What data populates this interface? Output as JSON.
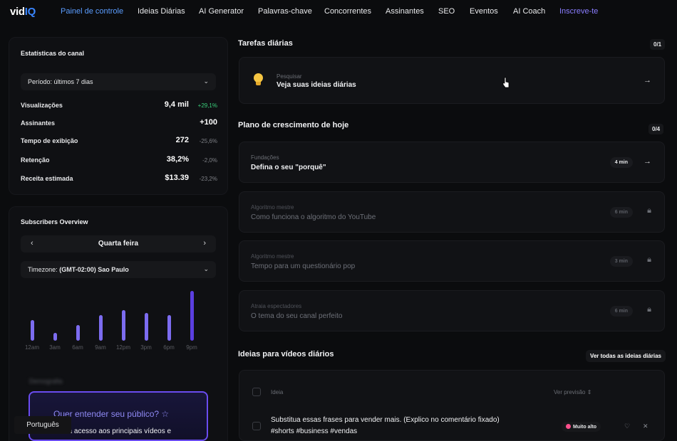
{
  "nav": {
    "logo_prefix": "vid",
    "logo_suffix": "IQ",
    "items": [
      "Painel de controle",
      "Ideias Diárias",
      "AI Generator",
      "Palavras-chave",
      "Concorrentes",
      "Assinantes",
      "SEO",
      "Eventos",
      "AI Coach",
      "Inscreve-te"
    ]
  },
  "stats_panel": {
    "title": "Estatísticas do canal",
    "period": "Período: últimos 7 dias",
    "rows": [
      {
        "label": "Visualizações",
        "value": "9,4 mil",
        "change": "+29,1%"
      },
      {
        "label": "Assinantes",
        "value": "+100",
        "change": ""
      },
      {
        "label": "Tempo de exibição",
        "value": "272",
        "change": "-25,6%"
      },
      {
        "label": "Retenção",
        "value": "38,2%",
        "change": "-2,0%"
      },
      {
        "label": "Receita estimada",
        "value": "$13.39",
        "change": "-23,2%"
      }
    ]
  },
  "subs_panel": {
    "title": "Subscribers Overview",
    "day": "Quarta feira",
    "timezone_label": "Timezone:",
    "timezone_value": "(GMT-02:00) Sao Paulo",
    "bar_labels": [
      "12am",
      "3am",
      "6am",
      "9am",
      "12pm",
      "3pm",
      "6pm",
      "9pm"
    ],
    "bar_levels": [
      0.42,
      0.15,
      0.32,
      0.52,
      0.61,
      0.55,
      0.52,
      1.0
    ],
    "bar_color": "#7c6cf0",
    "blurred_left": "Demografia",
    "promo_title": "Quer entender seu público? ☆",
    "promo_sub": "ha acesso aos principais vídeos e",
    "language": "Português"
  },
  "tasks": {
    "title": "Tarefas diárias",
    "count": "0/1",
    "item": {
      "sub": "Pesquisar",
      "main": "Veja suas ideias diárias"
    }
  },
  "plan": {
    "title": "Plano de crescimento de hoje",
    "count": "0/4",
    "items": [
      {
        "sub": "Fundações",
        "main": "Defina o seu \"porquê\"",
        "time": "4 min",
        "locked": false
      },
      {
        "sub": "Algoritmo mestre",
        "main": "Como funciona o algoritmo do YouTube",
        "time": "6 min",
        "locked": true
      },
      {
        "sub": "Algoritmo mestre",
        "main": "Tempo para um questionário pop",
        "time": "3 min",
        "locked": true
      },
      {
        "sub": "Atraia espectadores",
        "main": "O tema do seu canal perfeito",
        "time": "6 min",
        "locked": true
      }
    ]
  },
  "ideas": {
    "title": "Ideias para vídeos diários",
    "see_all": "Ver todas as ideias diárias",
    "col_idea": "Ideia",
    "col_preview": "Ver previsão",
    "row_line1": "Substitua essas frases para vender mais. (Explico no comentário fixado)",
    "row_line2": "#shorts #business #vendas",
    "score": "Muito alto"
  }
}
